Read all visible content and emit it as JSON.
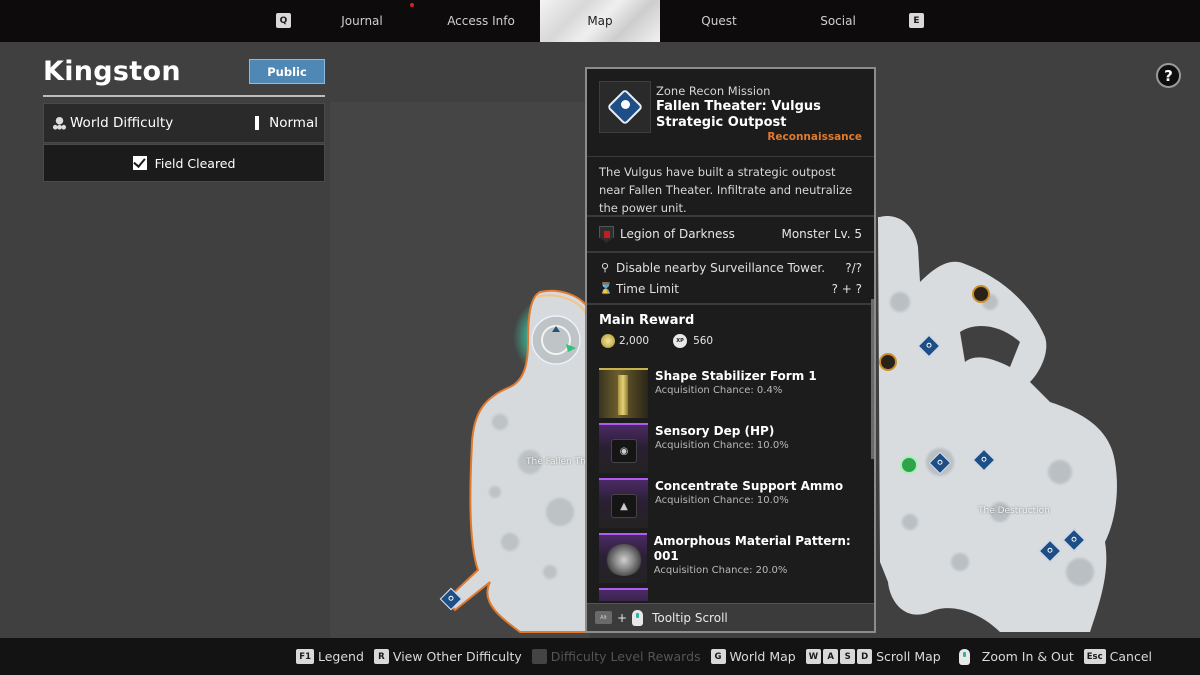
{
  "top_nav": {
    "left_key": "Q",
    "right_key": "E",
    "tabs": [
      {
        "label": "Journal",
        "active": false,
        "has_notification": true
      },
      {
        "label": "Access Info",
        "active": false
      },
      {
        "label": "Map",
        "active": true
      },
      {
        "label": "Quest",
        "active": false
      },
      {
        "label": "Social",
        "active": false
      }
    ]
  },
  "left_panel": {
    "region_name": "Kingston",
    "visibility_button": "Public",
    "world_difficulty_label": "World Difficulty",
    "world_difficulty_value": "Normal",
    "field_cleared_label": "Field Cleared",
    "field_cleared_checked": true
  },
  "help_button": "?",
  "map": {
    "labels": [
      "The Fallen Theater",
      "The Destruction"
    ],
    "colors": {
      "terrain": "#d9dcdf",
      "background": "#404040",
      "selected_glow": "#39e0b4",
      "zone_border": "#e07a2e",
      "mission_marker": "#1e4e86"
    }
  },
  "tooltip": {
    "mission_type": "Zone Recon Mission",
    "mission_name": "Fallen Theater: Vulgus Strategic Outpost",
    "tag": "Reconnaissance",
    "tag_color": "#e07a2e",
    "description": "The Vulgus have built a strategic outpost near Fallen Theater. Infiltrate and neutralize the power unit.",
    "faction": "Legion of Darkness",
    "monster_level": "Monster Lv. 5",
    "objectives": [
      {
        "icon": "surveillance-tower-icon",
        "label": "Disable nearby Surveillance Tower.",
        "value": "?/?"
      },
      {
        "icon": "hourglass-icon",
        "label": "Time Limit",
        "value": "? + ?"
      }
    ],
    "main_reward_title": "Main Reward",
    "currency": {
      "gold": "2,000",
      "xp": "560"
    },
    "rewards": [
      {
        "name": "Shape Stabilizer Form 1",
        "chance": "Acquisition Chance: 0.4%",
        "rarity": "gold",
        "icon": "stabilizer-icon"
      },
      {
        "name": "Sensory Dep (HP)",
        "chance": "Acquisition Chance: 10.0%",
        "rarity": "purple",
        "icon": "module-chip-icon"
      },
      {
        "name": "Concentrate Support Ammo",
        "chance": "Acquisition Chance: 10.0%",
        "rarity": "purple",
        "icon": "ammo-chip-icon"
      },
      {
        "name": "Amorphous Material Pattern: 001",
        "chance": "Acquisition Chance: 20.0%",
        "rarity": "purple",
        "icon": "amorphous-material-icon"
      },
      {
        "name": "",
        "chance": "",
        "rarity": "purple",
        "icon": "partial-item-icon"
      }
    ],
    "footer": {
      "key": "Alt",
      "label": "Tooltip Scroll"
    }
  },
  "bottom_bar": {
    "hints": [
      {
        "keys": [
          "F1"
        ],
        "label": "Legend",
        "enabled": true
      },
      {
        "keys": [
          "R"
        ],
        "label": "View Other Difficulty",
        "enabled": true
      },
      {
        "keys": [
          ""
        ],
        "label": "Difficulty Level Rewards",
        "enabled": false
      },
      {
        "keys": [
          "G"
        ],
        "label": "World Map",
        "enabled": true
      },
      {
        "keys": [
          "W",
          "A",
          "S",
          "D"
        ],
        "label": "Scroll Map",
        "enabled": true
      },
      {
        "keys": [],
        "label": "Zoom In & Out",
        "enabled": true,
        "mouse": true
      },
      {
        "keys": [
          "Esc"
        ],
        "label": "Cancel",
        "enabled": true
      }
    ]
  }
}
